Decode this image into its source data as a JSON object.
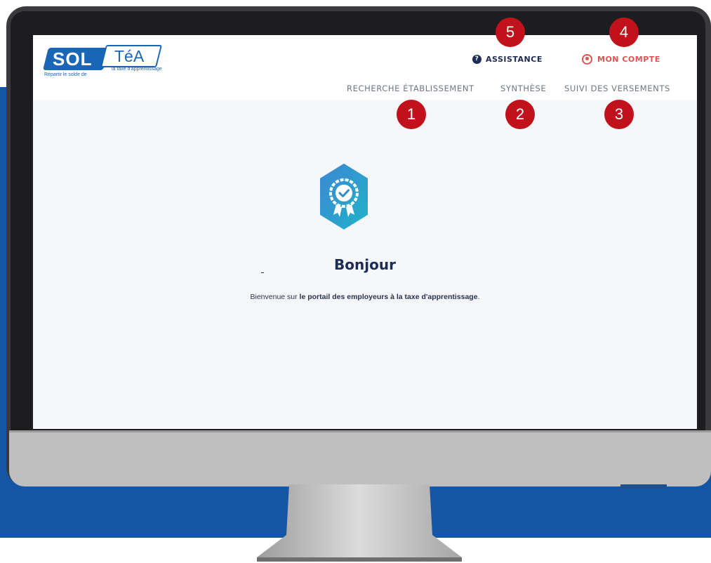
{
  "logo": {
    "brand_left": "SOL",
    "brand_right": "TéA",
    "tagline_left": "Répartir le solde de",
    "tagline_right": "la taxe d'apprentissage"
  },
  "header": {
    "assistance_label": "ASSISTANCE",
    "account_label": "MON COMPTE",
    "assistance_icon": "question-circle-icon",
    "account_icon": "user-circle-icon"
  },
  "menu": {
    "items": [
      {
        "label": "RECHERCHE ÉTABLISSEMENT"
      },
      {
        "label": "SYNTHÈSE"
      },
      {
        "label": "SUIVI DES VERSEMENTS"
      }
    ]
  },
  "badges": [
    "1",
    "2",
    "3",
    "4",
    "5"
  ],
  "main": {
    "hero_icon": "award-badge-icon",
    "greeting": "Bonjour",
    "welcome_prefix": "Bienvenue sur ",
    "welcome_strong": "le portail des employeurs à la taxe d'apprentissage",
    "welcome_suffix": "."
  },
  "colors": {
    "background_blue": "#1555a6",
    "brand_blue": "#1a66b6",
    "navy": "#1d2b57",
    "account_red": "#e05252",
    "badge_red": "#c1121c",
    "screen_bg": "#f6f7fb"
  }
}
